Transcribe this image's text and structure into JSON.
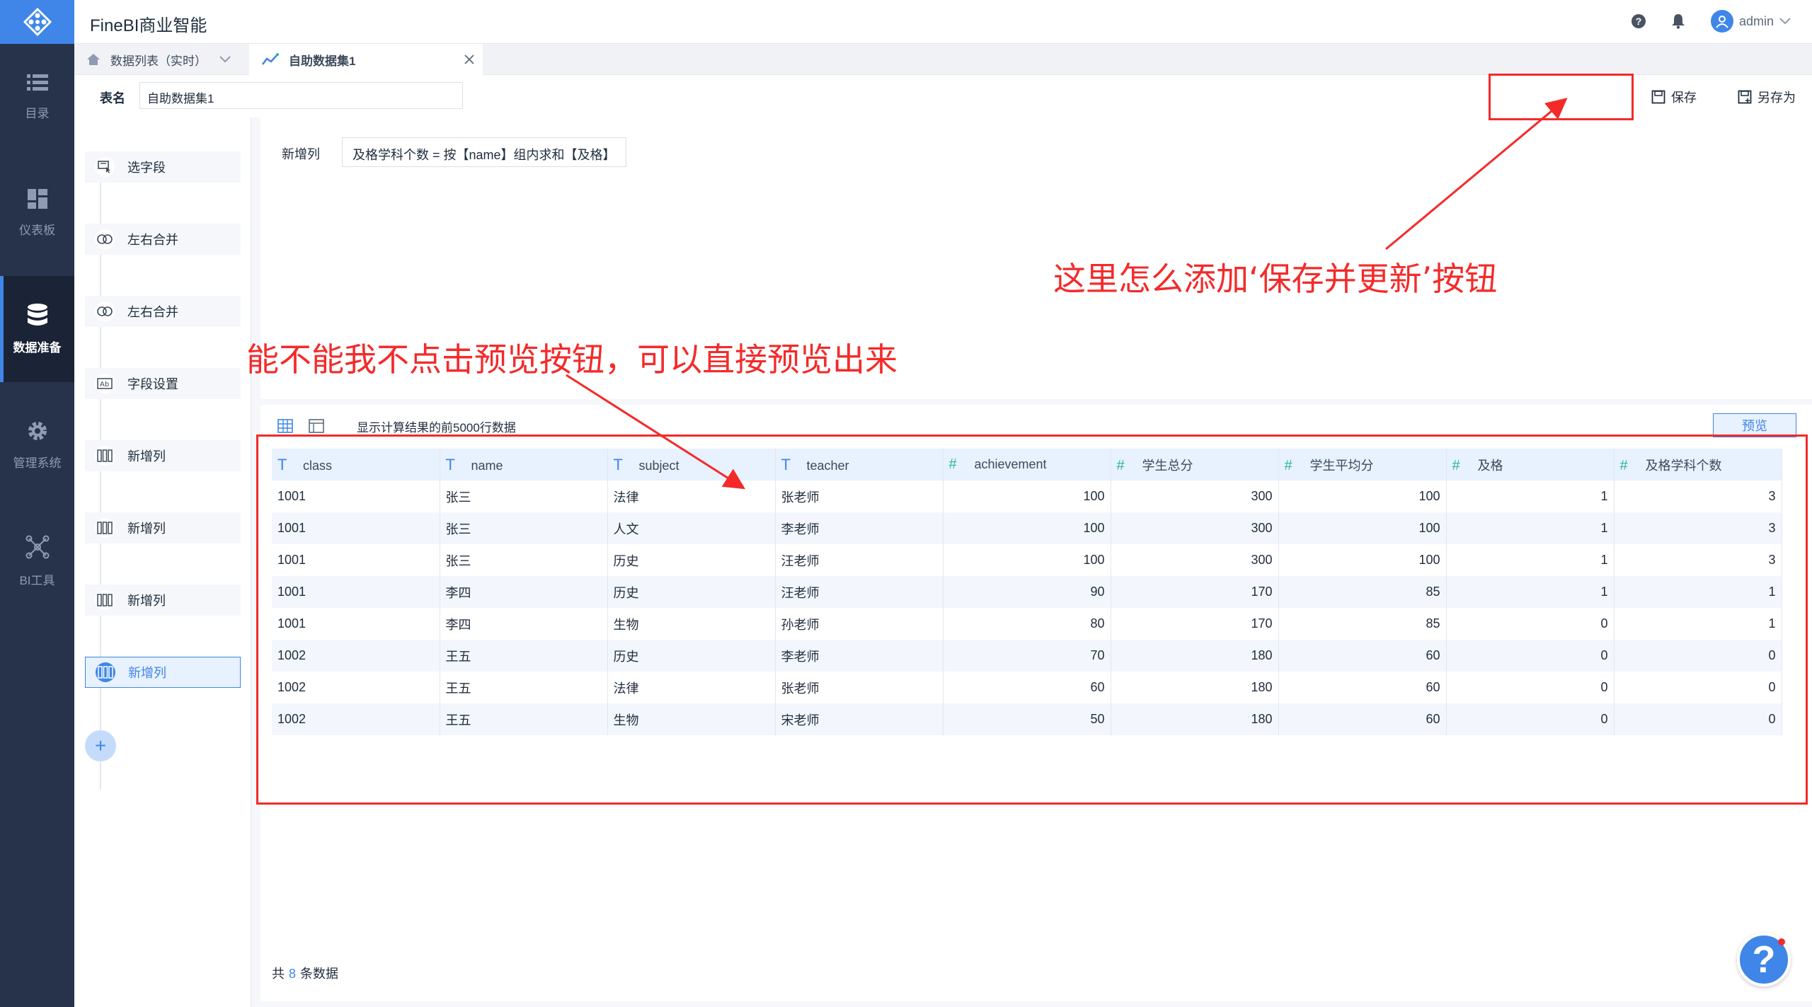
{
  "app": {
    "title": "FineBI商业智能",
    "user": "admin"
  },
  "nav": [
    {
      "label": "目录",
      "icon": "list-icon"
    },
    {
      "label": "仪表板",
      "icon": "dashboard-icon"
    },
    {
      "label": "数据准备",
      "icon": "database-icon",
      "active": true
    },
    {
      "label": "管理系统",
      "icon": "gear-icon"
    },
    {
      "label": "BI工具",
      "icon": "network-icon"
    }
  ],
  "tabs": [
    {
      "label": "数据列表（实时）"
    },
    {
      "label": "自助数据集1",
      "active": true
    }
  ],
  "namebar": {
    "label": "表名",
    "value": "自助数据集1",
    "save": "保存",
    "save_as": "另存为"
  },
  "steps": [
    {
      "label": "选字段",
      "icon": "select-field-icon"
    },
    {
      "label": "左右合并",
      "icon": "merge-icon"
    },
    {
      "label": "左右合并",
      "icon": "merge-icon"
    },
    {
      "label": "字段设置",
      "icon": "field-setting-icon"
    },
    {
      "label": "新增列",
      "icon": "add-column-icon"
    },
    {
      "label": "新增列",
      "icon": "add-column-icon"
    },
    {
      "label": "新增列",
      "icon": "add-column-icon"
    },
    {
      "label": "新增列",
      "icon": "add-column-icon",
      "active": true
    }
  ],
  "formula": {
    "label": "新增列",
    "expr": "及格学科个数 = 按【name】组内求和【及格】"
  },
  "preview": {
    "note": "显示计算结果的前5000行数据",
    "button": "预览",
    "footer_prefix": "共",
    "footer_count": "8",
    "footer_suffix": "条数据",
    "columns": [
      {
        "name": "class",
        "type": "T"
      },
      {
        "name": "name",
        "type": "T"
      },
      {
        "name": "subject",
        "type": "T"
      },
      {
        "name": "teacher",
        "type": "T"
      },
      {
        "name": "achievement",
        "type": "#"
      },
      {
        "name": "学生总分",
        "type": "#"
      },
      {
        "name": "学生平均分",
        "type": "#"
      },
      {
        "name": "及格",
        "type": "#"
      },
      {
        "name": "及格学科个数",
        "type": "#"
      }
    ],
    "rows": [
      [
        "1001",
        "张三",
        "法律",
        "张老师",
        "100",
        "300",
        "100",
        "1",
        "3"
      ],
      [
        "1001",
        "张三",
        "人文",
        "李老师",
        "100",
        "300",
        "100",
        "1",
        "3"
      ],
      [
        "1001",
        "张三",
        "历史",
        "汪老师",
        "100",
        "300",
        "100",
        "1",
        "3"
      ],
      [
        "1001",
        "李四",
        "历史",
        "汪老师",
        "90",
        "170",
        "85",
        "1",
        "1"
      ],
      [
        "1001",
        "李四",
        "生物",
        "孙老师",
        "80",
        "170",
        "85",
        "0",
        "1"
      ],
      [
        "1002",
        "王五",
        "历史",
        "李老师",
        "70",
        "180",
        "60",
        "0",
        "0"
      ],
      [
        "1002",
        "王五",
        "法律",
        "张老师",
        "60",
        "180",
        "60",
        "0",
        "0"
      ],
      [
        "1002",
        "王五",
        "生物",
        "宋老师",
        "50",
        "180",
        "60",
        "0",
        "0"
      ]
    ]
  },
  "annotations": {
    "save_update": "这里怎么添加‘保存并更新’按钮",
    "auto_preview": "能不能我不点击预览按钮，可以直接预览出来"
  },
  "colors": {
    "accent": "#3f86e8",
    "nav_bg": "#26334b",
    "annotation": "#f42a2a"
  }
}
